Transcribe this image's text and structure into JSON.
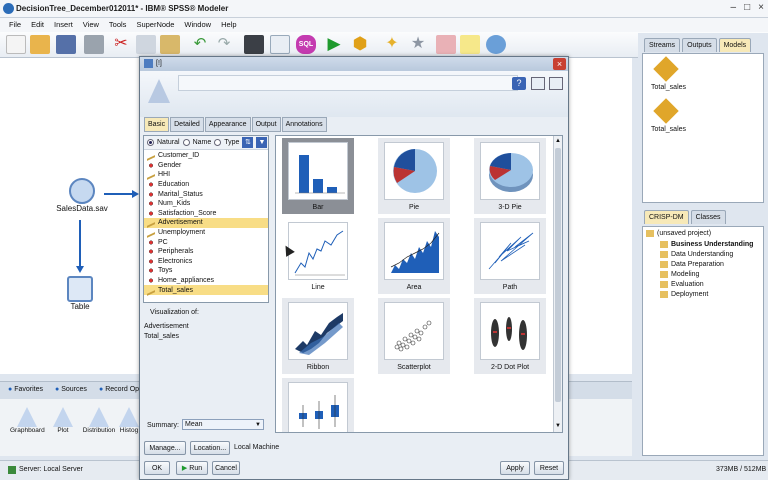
{
  "app": {
    "title": "DecisionTree_December012011* - IBM® SPSS® Modeler",
    "menu": [
      "File",
      "Edit",
      "Insert",
      "View",
      "Tools",
      "SuperNode",
      "Window",
      "Help"
    ]
  },
  "canvas": {
    "nodes": [
      {
        "label": "SalesData.sav",
        "icon": "data-file-icon"
      },
      {
        "label": "Table",
        "icon": "table-icon"
      }
    ]
  },
  "right_panel": {
    "top_tabs": [
      "Streams",
      "Outputs",
      "Models"
    ],
    "models": [
      "Total_sales",
      "Total_sales"
    ],
    "bottom_tabs": [
      "CRISP-DM",
      "Classes"
    ],
    "project": {
      "root": "(unsaved project)",
      "items": [
        "Business Understanding",
        "Data Understanding",
        "Data Preparation",
        "Modeling",
        "Evaluation",
        "Deployment"
      ]
    }
  },
  "palette": {
    "tabs": [
      "Favorites",
      "Sources",
      "Record Ops"
    ],
    "nodes": [
      "Graphboard",
      "Plot",
      "Distribution",
      "Histog"
    ]
  },
  "status": {
    "server": "Server: Local Server",
    "memory": "373MB / 512MB"
  },
  "dialog": {
    "title": "[!]",
    "tabs": [
      "Basic",
      "Detailed",
      "Appearance",
      "Output",
      "Annotations"
    ],
    "sort_options": [
      "Natural",
      "Name",
      "Type"
    ],
    "fields": [
      {
        "name": "Customer_ID",
        "type": "ruler"
      },
      {
        "name": "Gender",
        "type": "set"
      },
      {
        "name": "HHI",
        "type": "ruler"
      },
      {
        "name": "Education",
        "type": "set"
      },
      {
        "name": "Marital_Status",
        "type": "set"
      },
      {
        "name": "Num_Kids",
        "type": "set"
      },
      {
        "name": "Satisfaction_Score",
        "type": "set"
      },
      {
        "name": "Advertisement",
        "type": "ruler"
      },
      {
        "name": "Unemployment",
        "type": "ruler"
      },
      {
        "name": "PC",
        "type": "set"
      },
      {
        "name": "Peripherals",
        "type": "set"
      },
      {
        "name": "Electronics",
        "type": "set"
      },
      {
        "name": "Toys",
        "type": "set"
      },
      {
        "name": "Home_appliances",
        "type": "set"
      },
      {
        "name": "Total_sales",
        "type": "ruler"
      }
    ],
    "selected_fields": [
      "Advertisement",
      "Total_sales"
    ],
    "visualization_label": "Visualization of:",
    "visualization_items": [
      "Advertisement",
      "Total_sales"
    ],
    "summary_label": "Summary:",
    "summary_value": "Mean",
    "chart_types": [
      "Bar",
      "Pie",
      "3-D Pie",
      "Line",
      "Area",
      "Path",
      "Ribbon",
      "Scatterplot",
      "2-D Dot Plot"
    ],
    "manage_label": "Manage...",
    "location_label": "Location...",
    "location_value": "Local Machine",
    "buttons": {
      "ok": "OK",
      "run": "Run",
      "cancel": "Cancel",
      "apply": "Apply",
      "reset": "Reset"
    }
  },
  "colors": {
    "accent_blue": "#1f5fb8",
    "selection_yellow": "#f8dd86",
    "close_red": "#c84032"
  }
}
